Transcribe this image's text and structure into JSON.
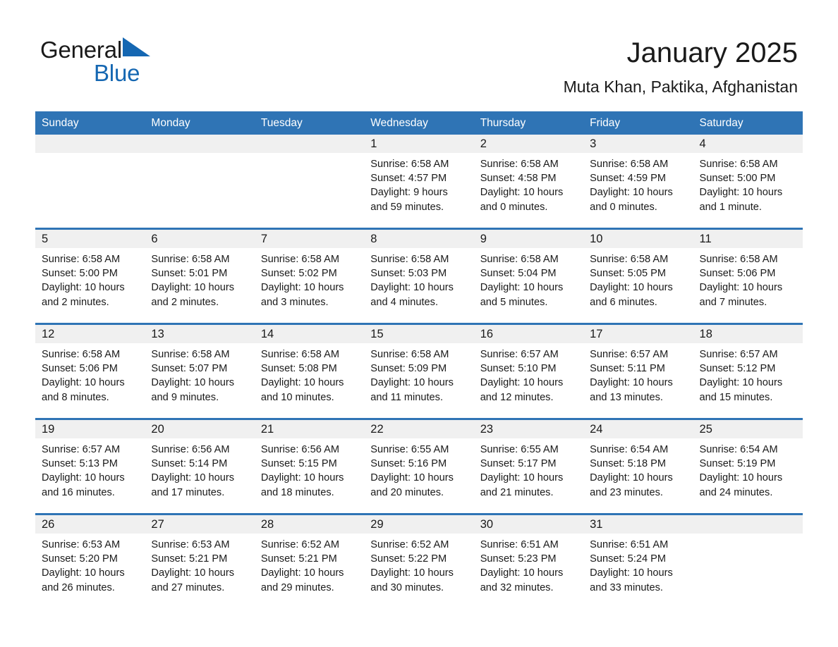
{
  "brand": {
    "name_part1": "General",
    "name_part2": "Blue",
    "triangle_color": "#1567b2"
  },
  "header": {
    "title": "January 2025",
    "subtitle": "Muta Khan, Paktika, Afghanistan",
    "accent_color": "#2f74b5",
    "band_color": "#f0f0f0"
  },
  "calendar": {
    "weekday_headers": [
      "Sunday",
      "Monday",
      "Tuesday",
      "Wednesday",
      "Thursday",
      "Friday",
      "Saturday"
    ],
    "weeks": [
      [
        {
          "day": "",
          "sunrise": "",
          "sunset": "",
          "daylight1": "",
          "daylight2": ""
        },
        {
          "day": "",
          "sunrise": "",
          "sunset": "",
          "daylight1": "",
          "daylight2": ""
        },
        {
          "day": "",
          "sunrise": "",
          "sunset": "",
          "daylight1": "",
          "daylight2": ""
        },
        {
          "day": "1",
          "sunrise": "Sunrise: 6:58 AM",
          "sunset": "Sunset: 4:57 PM",
          "daylight1": "Daylight: 9 hours",
          "daylight2": "and 59 minutes."
        },
        {
          "day": "2",
          "sunrise": "Sunrise: 6:58 AM",
          "sunset": "Sunset: 4:58 PM",
          "daylight1": "Daylight: 10 hours",
          "daylight2": "and 0 minutes."
        },
        {
          "day": "3",
          "sunrise": "Sunrise: 6:58 AM",
          "sunset": "Sunset: 4:59 PM",
          "daylight1": "Daylight: 10 hours",
          "daylight2": "and 0 minutes."
        },
        {
          "day": "4",
          "sunrise": "Sunrise: 6:58 AM",
          "sunset": "Sunset: 5:00 PM",
          "daylight1": "Daylight: 10 hours",
          "daylight2": "and 1 minute."
        }
      ],
      [
        {
          "day": "5",
          "sunrise": "Sunrise: 6:58 AM",
          "sunset": "Sunset: 5:00 PM",
          "daylight1": "Daylight: 10 hours",
          "daylight2": "and 2 minutes."
        },
        {
          "day": "6",
          "sunrise": "Sunrise: 6:58 AM",
          "sunset": "Sunset: 5:01 PM",
          "daylight1": "Daylight: 10 hours",
          "daylight2": "and 2 minutes."
        },
        {
          "day": "7",
          "sunrise": "Sunrise: 6:58 AM",
          "sunset": "Sunset: 5:02 PM",
          "daylight1": "Daylight: 10 hours",
          "daylight2": "and 3 minutes."
        },
        {
          "day": "8",
          "sunrise": "Sunrise: 6:58 AM",
          "sunset": "Sunset: 5:03 PM",
          "daylight1": "Daylight: 10 hours",
          "daylight2": "and 4 minutes."
        },
        {
          "day": "9",
          "sunrise": "Sunrise: 6:58 AM",
          "sunset": "Sunset: 5:04 PM",
          "daylight1": "Daylight: 10 hours",
          "daylight2": "and 5 minutes."
        },
        {
          "day": "10",
          "sunrise": "Sunrise: 6:58 AM",
          "sunset": "Sunset: 5:05 PM",
          "daylight1": "Daylight: 10 hours",
          "daylight2": "and 6 minutes."
        },
        {
          "day": "11",
          "sunrise": "Sunrise: 6:58 AM",
          "sunset": "Sunset: 5:06 PM",
          "daylight1": "Daylight: 10 hours",
          "daylight2": "and 7 minutes."
        }
      ],
      [
        {
          "day": "12",
          "sunrise": "Sunrise: 6:58 AM",
          "sunset": "Sunset: 5:06 PM",
          "daylight1": "Daylight: 10 hours",
          "daylight2": "and 8 minutes."
        },
        {
          "day": "13",
          "sunrise": "Sunrise: 6:58 AM",
          "sunset": "Sunset: 5:07 PM",
          "daylight1": "Daylight: 10 hours",
          "daylight2": "and 9 minutes."
        },
        {
          "day": "14",
          "sunrise": "Sunrise: 6:58 AM",
          "sunset": "Sunset: 5:08 PM",
          "daylight1": "Daylight: 10 hours",
          "daylight2": "and 10 minutes."
        },
        {
          "day": "15",
          "sunrise": "Sunrise: 6:58 AM",
          "sunset": "Sunset: 5:09 PM",
          "daylight1": "Daylight: 10 hours",
          "daylight2": "and 11 minutes."
        },
        {
          "day": "16",
          "sunrise": "Sunrise: 6:57 AM",
          "sunset": "Sunset: 5:10 PM",
          "daylight1": "Daylight: 10 hours",
          "daylight2": "and 12 minutes."
        },
        {
          "day": "17",
          "sunrise": "Sunrise: 6:57 AM",
          "sunset": "Sunset: 5:11 PM",
          "daylight1": "Daylight: 10 hours",
          "daylight2": "and 13 minutes."
        },
        {
          "day": "18",
          "sunrise": "Sunrise: 6:57 AM",
          "sunset": "Sunset: 5:12 PM",
          "daylight1": "Daylight: 10 hours",
          "daylight2": "and 15 minutes."
        }
      ],
      [
        {
          "day": "19",
          "sunrise": "Sunrise: 6:57 AM",
          "sunset": "Sunset: 5:13 PM",
          "daylight1": "Daylight: 10 hours",
          "daylight2": "and 16 minutes."
        },
        {
          "day": "20",
          "sunrise": "Sunrise: 6:56 AM",
          "sunset": "Sunset: 5:14 PM",
          "daylight1": "Daylight: 10 hours",
          "daylight2": "and 17 minutes."
        },
        {
          "day": "21",
          "sunrise": "Sunrise: 6:56 AM",
          "sunset": "Sunset: 5:15 PM",
          "daylight1": "Daylight: 10 hours",
          "daylight2": "and 18 minutes."
        },
        {
          "day": "22",
          "sunrise": "Sunrise: 6:55 AM",
          "sunset": "Sunset: 5:16 PM",
          "daylight1": "Daylight: 10 hours",
          "daylight2": "and 20 minutes."
        },
        {
          "day": "23",
          "sunrise": "Sunrise: 6:55 AM",
          "sunset": "Sunset: 5:17 PM",
          "daylight1": "Daylight: 10 hours",
          "daylight2": "and 21 minutes."
        },
        {
          "day": "24",
          "sunrise": "Sunrise: 6:54 AM",
          "sunset": "Sunset: 5:18 PM",
          "daylight1": "Daylight: 10 hours",
          "daylight2": "and 23 minutes."
        },
        {
          "day": "25",
          "sunrise": "Sunrise: 6:54 AM",
          "sunset": "Sunset: 5:19 PM",
          "daylight1": "Daylight: 10 hours",
          "daylight2": "and 24 minutes."
        }
      ],
      [
        {
          "day": "26",
          "sunrise": "Sunrise: 6:53 AM",
          "sunset": "Sunset: 5:20 PM",
          "daylight1": "Daylight: 10 hours",
          "daylight2": "and 26 minutes."
        },
        {
          "day": "27",
          "sunrise": "Sunrise: 6:53 AM",
          "sunset": "Sunset: 5:21 PM",
          "daylight1": "Daylight: 10 hours",
          "daylight2": "and 27 minutes."
        },
        {
          "day": "28",
          "sunrise": "Sunrise: 6:52 AM",
          "sunset": "Sunset: 5:21 PM",
          "daylight1": "Daylight: 10 hours",
          "daylight2": "and 29 minutes."
        },
        {
          "day": "29",
          "sunrise": "Sunrise: 6:52 AM",
          "sunset": "Sunset: 5:22 PM",
          "daylight1": "Daylight: 10 hours",
          "daylight2": "and 30 minutes."
        },
        {
          "day": "30",
          "sunrise": "Sunrise: 6:51 AM",
          "sunset": "Sunset: 5:23 PM",
          "daylight1": "Daylight: 10 hours",
          "daylight2": "and 32 minutes."
        },
        {
          "day": "31",
          "sunrise": "Sunrise: 6:51 AM",
          "sunset": "Sunset: 5:24 PM",
          "daylight1": "Daylight: 10 hours",
          "daylight2": "and 33 minutes."
        },
        {
          "day": "",
          "sunrise": "",
          "sunset": "",
          "daylight1": "",
          "daylight2": ""
        }
      ]
    ]
  }
}
